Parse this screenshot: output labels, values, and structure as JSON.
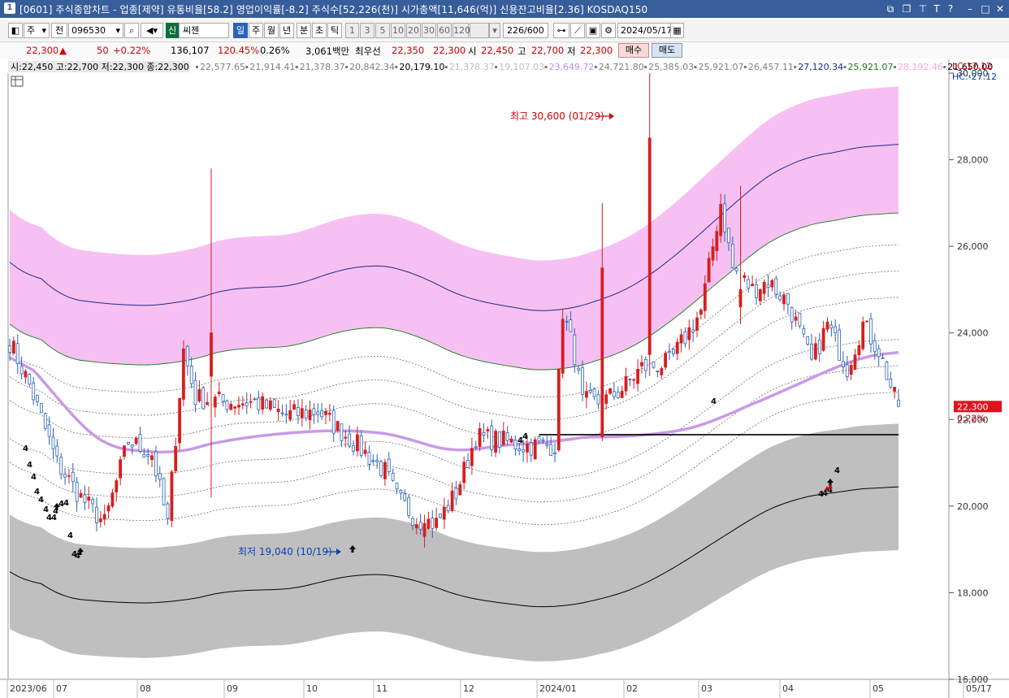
{
  "title_bar": {
    "icon": "1",
    "text": "[0601] 주식종합차트 - 업종[제약] 유통비율[58.2] 영업이익률[-8.2] 주식수[52,226(천)] 시가총액[11,646(억)] 신용잔고비율[2.36] KOSDAQ150",
    "controls": [
      "copy-icon",
      "window-icon",
      "pin-icon",
      "T",
      "?",
      "minimize-icon",
      "maximize-icon",
      "close-icon"
    ]
  },
  "toolbar": {
    "period_select": "주",
    "prev_label": "전",
    "code_value": "096530",
    "credit_badge": "신",
    "stock_name": "씨젠",
    "period_tabs": [
      "일",
      "주",
      "월",
      "년",
      "분",
      "초",
      "틱"
    ],
    "active_tab": "일",
    "interval_buttons": [
      "1",
      "3",
      "5",
      "10",
      "20",
      "30",
      "60",
      "120"
    ],
    "count_value": "226",
    "count_total": "/600",
    "date_value": "2024/05/17"
  },
  "quote_bar": {
    "price": "22,300",
    "arrow": "▲",
    "change": "50",
    "change_pct": "+0.22%",
    "volume": "136,107",
    "volume_ratio": "120.45%",
    "turnover": "0.26%",
    "amount": "3,061백만",
    "best_bid_label": "최우선",
    "best_bid": "22,350",
    "best_ask": "22,300",
    "open_label": "시",
    "open": "22,450",
    "high_label": "고",
    "high": "22,700",
    "low_label": "저",
    "low": "22,300",
    "buy_button": "매수",
    "sell_button": "매도"
  },
  "indicator_line": {
    "ohlc": "시:22,450 고:22,700 저:22,300 종:22,300",
    "values": [
      {
        "text": "22,577.65",
        "color": "#7f7f7f"
      },
      {
        "text": "21,914.41",
        "color": "#7f7f7f"
      },
      {
        "text": "21,378.37",
        "color": "#7f7f7f"
      },
      {
        "text": "20,842.34",
        "color": "#7f7f7f"
      },
      {
        "text": "20,179.10",
        "color": "#000000"
      },
      {
        "text": "21,378.37",
        "color": "#bdbdbd"
      },
      {
        "text": "19,107.03",
        "color": "#bdbdbd"
      },
      {
        "text": "23,649.72",
        "color": "#c08ce8"
      },
      {
        "text": "24,721.80",
        "color": "#7f7f7f"
      },
      {
        "text": "25,385.03",
        "color": "#7f7f7f"
      },
      {
        "text": "25,921.07",
        "color": "#7f7f7f"
      },
      {
        "text": "26,457.11",
        "color": "#7f7f7f"
      },
      {
        "text": "27,120.34",
        "color": "#1f2a8c"
      },
      {
        "text": "25,921.07",
        "color": "#1a7a1a"
      },
      {
        "text": "28,192.46",
        "color": "#f3a7e9"
      },
      {
        "text": "21,650.00",
        "color": "#000000"
      }
    ],
    "lc": "LC:17.12",
    "hc": "HC:-27.12"
  },
  "chart_data": {
    "type": "candlestick",
    "y_axis": {
      "min": 16000,
      "max": 30000,
      "ticks": [
        "30,000",
        "28,000",
        "26,000",
        "24,000",
        "22,000",
        "20,000",
        "18,000",
        "16,000"
      ]
    },
    "x_axis": {
      "labels": [
        "2023/06",
        "07",
        "08",
        "09",
        "10",
        "11",
        "12",
        "2024/01",
        "02",
        "03",
        "04",
        "05",
        "05/17"
      ]
    },
    "last_price_label": "22,300",
    "last_change_label": "0.22%",
    "high_annotation": "최고 30,600 (01/29)",
    "low_annotation": "최저 19,040 (10/19)",
    "horizontal_line_value": 21650,
    "marker_text": "4",
    "colors": {
      "up": "#d81e1e",
      "down": "#2a62b8",
      "upper_band": "#f7c0f2",
      "lower_band": "#bfbfbf",
      "mid_line": "#c99ae8"
    }
  }
}
